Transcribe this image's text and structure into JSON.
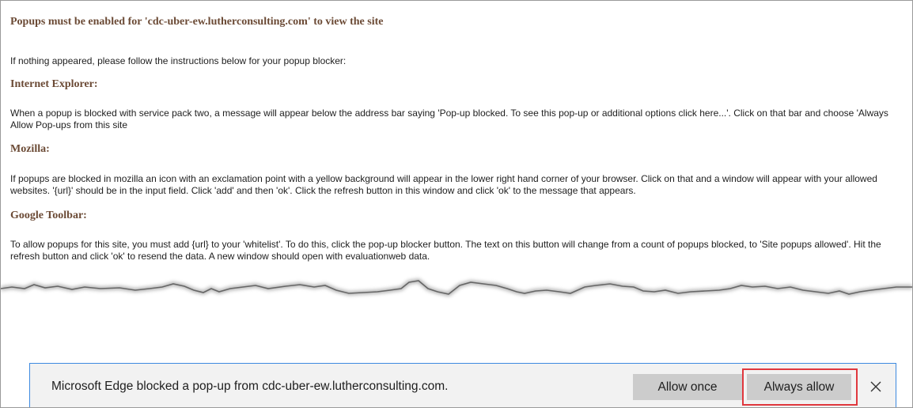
{
  "page": {
    "title": "Popups must be enabled for 'cdc-uber-ew.lutherconsulting.com' to view the site",
    "intro": "If nothing appeared, please follow the instructions below for your popup blocker:",
    "sections": [
      {
        "heading": "Internet Explorer:",
        "text": "When a popup is blocked with service pack two, a message will appear below the address bar saying 'Pop-up blocked. To see this pop-up or additional options click here...'. Click on that bar and choose 'Always Allow Pop-ups from this site"
      },
      {
        "heading": "Mozilla:",
        "text": "If popups are blocked in mozilla an icon with an exclamation point with a yellow background will appear in the lower right hand corner of your browser. Click on that and a window will appear with your allowed websites. '{url}' should be in the input field. Click 'add' and then 'ok'. Click the refresh button in this window and click 'ok' to the message that appears."
      },
      {
        "heading": "Google Toolbar:",
        "text": "To allow popups for this site, you must add {url} to your 'whitelist'. To do this, click the pop-up blocker button. The text on this button will change from a count of popups blocked, to 'Site popups allowed'. Hit the refresh button and click 'ok' to resend the data. A new window should open with evaluationweb data."
      }
    ]
  },
  "notification": {
    "message": "Microsoft Edge blocked a pop-up from cdc-uber-ew.lutherconsulting.com.",
    "allow_once_label": "Allow once",
    "always_allow_label": "Always allow",
    "close_icon": "close-icon"
  },
  "colors": {
    "heading": "#6b4a35",
    "notification_border": "#3d8ae0",
    "highlight": "#e0383e",
    "button_bg": "#cccccc"
  }
}
